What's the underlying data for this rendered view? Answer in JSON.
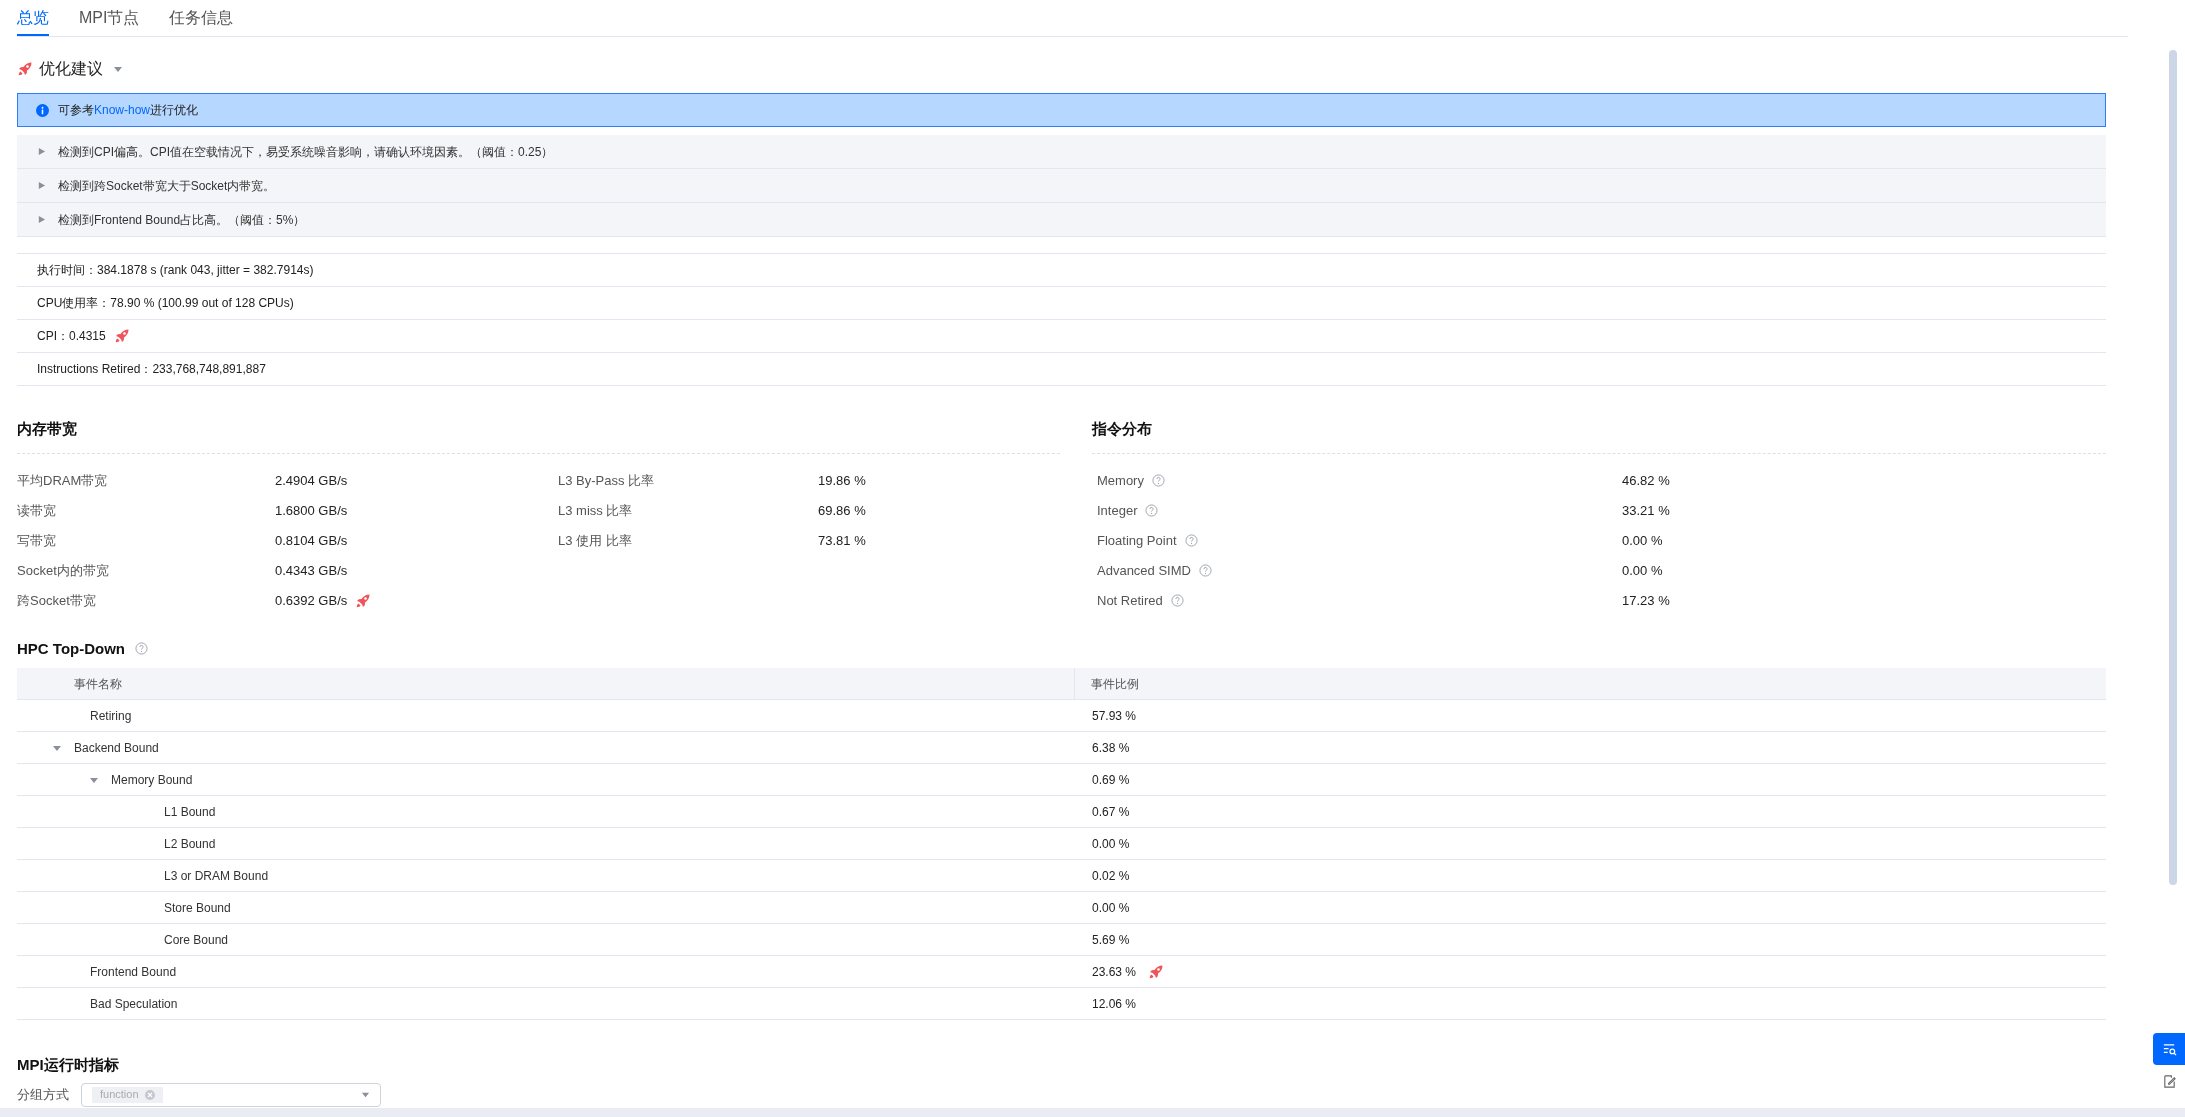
{
  "tabs": [
    {
      "label": "总览",
      "selected": true
    },
    {
      "label": "MPI节点",
      "selected": false
    },
    {
      "label": "任务信息",
      "selected": false
    }
  ],
  "suggestions": {
    "title": "优化建议",
    "expanded": true,
    "notice": {
      "text_before": "可参考",
      "link": "Know-how",
      "text_after": "进行优化"
    },
    "items": [
      {
        "text": "检测到CPI偏高。CPI值在空载情况下，易受系统噪音影响，请确认环境因素。（阈值：0.25）",
        "expanded": false
      },
      {
        "text": "检测到跨Socket带宽大于Socket内带宽。",
        "expanded": false
      },
      {
        "text": "检测到Frontend Bound占比高。（阈值：5%）",
        "expanded": false
      }
    ]
  },
  "summary": [
    {
      "text": "执行时间：384.1878 s (rank 043, jitter = 382.7914s)",
      "warning": false
    },
    {
      "text": "CPU使用率：78.90 % (100.99 out of 128 CPUs)",
      "warning": false
    },
    {
      "text": "CPI：0.4315",
      "warning": true
    },
    {
      "text": "Instructions Retired：233,768,748,891,887",
      "warning": false
    }
  ],
  "memory_bandwidth": {
    "title": "内存带宽",
    "rows": [
      {
        "label": "平均DRAM带宽",
        "value": "2.4904 GB/s",
        "warning": false
      },
      {
        "label": "读带宽",
        "value": "1.6800 GB/s",
        "warning": false
      },
      {
        "label": "写带宽",
        "value": "0.8104 GB/s",
        "warning": false
      },
      {
        "label": "Socket内的带宽",
        "value": "0.4343 GB/s",
        "warning": false
      },
      {
        "label": "跨Socket带宽",
        "value": "0.6392 GB/s",
        "warning": true
      }
    ],
    "ratios": [
      {
        "label": "L3 By-Pass 比率",
        "value": "19.86 %"
      },
      {
        "label": "L3 miss 比率",
        "value": "69.86 %"
      },
      {
        "label": "L3 使用 比率",
        "value": "73.81 %"
      }
    ]
  },
  "instruction_distribution": {
    "title": "指令分布",
    "rows": [
      {
        "label": "Memory",
        "value": "46.82 %"
      },
      {
        "label": "Integer",
        "value": "33.21 %"
      },
      {
        "label": "Floating Point",
        "value": "0.00 %"
      },
      {
        "label": "Advanced SIMD",
        "value": "0.00 %"
      },
      {
        "label": "Not Retired",
        "value": "17.23 %"
      }
    ]
  },
  "top_down": {
    "title": "HPC Top-Down",
    "columns": [
      "事件名称",
      "事件比例"
    ],
    "rows": [
      {
        "name": "Retiring",
        "value": "57.93 %",
        "warning": false
      },
      {
        "name": "Backend Bound",
        "value": "6.38 %",
        "warning": false,
        "expanded": true,
        "children": [
          {
            "name": "Memory Bound",
            "value": "0.69 %",
            "warning": false,
            "expanded": true,
            "children": [
              {
                "name": "L1 Bound",
                "value": "0.67 %",
                "warning": false
              },
              {
                "name": "L2 Bound",
                "value": "0.00 %",
                "warning": false
              },
              {
                "name": "L3 or DRAM Bound",
                "value": "0.02 %",
                "warning": false
              },
              {
                "name": "Store Bound",
                "value": "0.00 %",
                "warning": false
              },
              {
                "name": "Core Bound",
                "value": "5.69 %",
                "warning": false
              }
            ]
          }
        ]
      },
      {
        "name": "Frontend Bound",
        "value": "23.63 %",
        "warning": true
      },
      {
        "name": "Bad Speculation",
        "value": "12.06 %",
        "warning": false
      }
    ]
  },
  "mpi_metrics": {
    "title": "MPI运行时指标",
    "group_label": "分组方式",
    "group_tags": [
      "function"
    ]
  }
}
